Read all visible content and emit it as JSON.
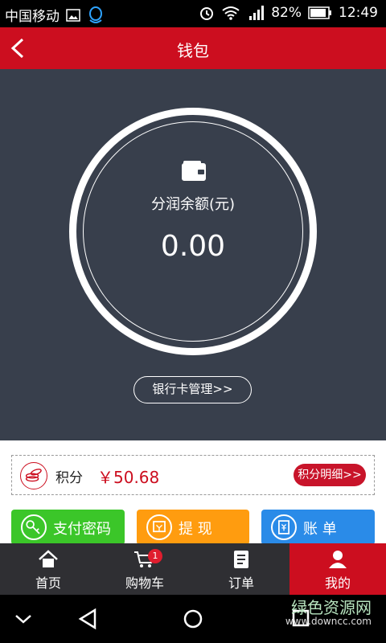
{
  "status_bar": {
    "carrier": "中国移动",
    "battery": "82%",
    "time": "12:49"
  },
  "header": {
    "title": "钱包"
  },
  "wallet": {
    "balance_label": "分润余额(元)",
    "balance_value": "0.00",
    "bank_card_button": "银行卡管理>>"
  },
  "points": {
    "label": "积分",
    "value": "￥50.68",
    "detail_button": "积分明细>>"
  },
  "actions": [
    {
      "label": "支付密码",
      "color": "#3bc629"
    },
    {
      "label": "提 现",
      "color": "#ff9c0f"
    },
    {
      "label": "账 单",
      "color": "#2a8be8"
    }
  ],
  "tabs": [
    {
      "label": "首页",
      "icon": "home-icon"
    },
    {
      "label": "购物车",
      "icon": "cart-icon",
      "badge": "1"
    },
    {
      "label": "订单",
      "icon": "order-icon"
    },
    {
      "label": "我的",
      "icon": "user-icon",
      "active": true
    }
  ],
  "watermark": {
    "title": "绿色资源网",
    "url": "www.downcc.com"
  },
  "colors": {
    "brand_red": "#cc0e1f",
    "panel_dark": "#383f4c",
    "tabbar_dark": "#2f2f33"
  }
}
